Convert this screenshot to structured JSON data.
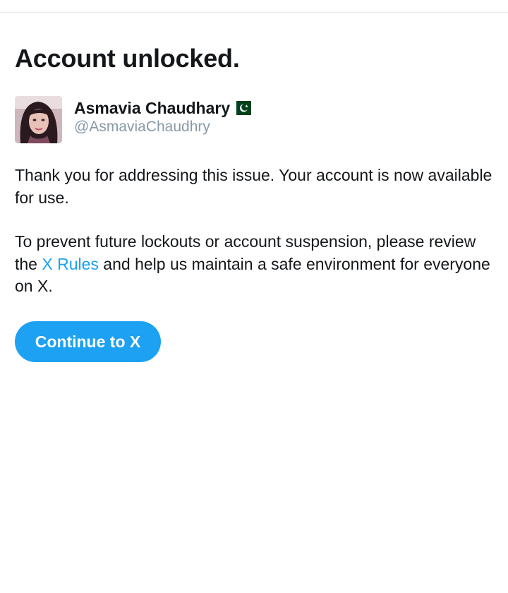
{
  "header": {
    "title": "Account unlocked."
  },
  "profile": {
    "display_name": "Asmavia Chaudhary",
    "flag_icon": "pakistan-flag-icon",
    "handle": "@AsmaviaChaudhry"
  },
  "message": {
    "paragraph_1": "Thank you for addressing this issue. Your account is now available for use.",
    "paragraph_2_before_link": "To prevent future lockouts or account suspension, please review the ",
    "rules_link_label": "X Rules",
    "paragraph_2_after_link": " and help us maintain a safe environment for everyone on X."
  },
  "actions": {
    "continue_label": "Continue to X"
  },
  "colors": {
    "accent": "#1da1f2",
    "text_primary": "#14171a",
    "text_secondary": "#8899a6",
    "divider": "#e1e8ed"
  }
}
